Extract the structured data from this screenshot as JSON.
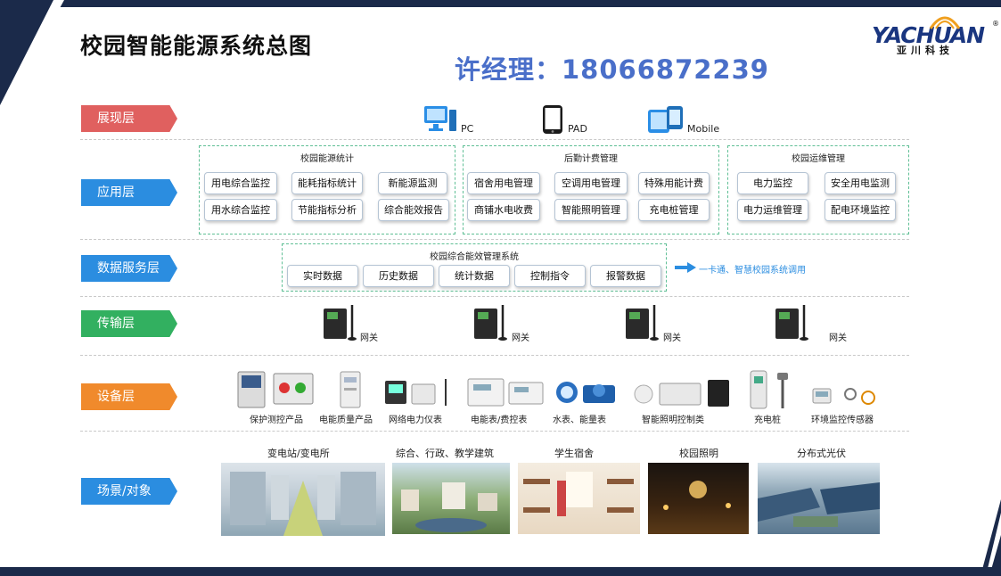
{
  "title": "校园智能能源系统总图",
  "contact": "许经理：18066872239",
  "logo": {
    "text": "YACHUAN",
    "sub": "亚川科技",
    "reg": "®"
  },
  "colors": {
    "presentation": "#e0605f",
    "application": "#2b8de0",
    "data_service": "#2b8de0",
    "transport": "#32b060",
    "device": "#f08a2c",
    "scene": "#2b8de0",
    "group_border": "#5fbf95"
  },
  "layers": {
    "presentation": "展现层",
    "application": "应用层",
    "data_service": "数据服务层",
    "transport": "传输层",
    "device": "设备层",
    "scene": "场景/对象"
  },
  "terminals": [
    {
      "icon": "pc-monitor-icon",
      "label": "PC"
    },
    {
      "icon": "tablet-icon",
      "label": "PAD"
    },
    {
      "icon": "mobile-icon",
      "label": "Mobile"
    }
  ],
  "app_groups": [
    {
      "title": "校园能源统计",
      "items": [
        "用电综合监控",
        "能耗指标统计",
        "新能源监测",
        "用水综合监控",
        "节能指标分析",
        "综合能效报告"
      ]
    },
    {
      "title": "后勤计费管理",
      "items": [
        "宿舍用电管理",
        "空调用电管理",
        "特殊用能计费",
        "商铺水电收费",
        "智能照明管理",
        "充电桩管理"
      ]
    },
    {
      "title": "校园运维管理",
      "items": [
        "电力监控",
        "安全用电监测",
        "电力运维管理",
        "配电环境监控"
      ]
    }
  ],
  "data_system": {
    "title": "校园综合能效管理系统",
    "items": [
      "实时数据",
      "历史数据",
      "统计数据",
      "控制指令",
      "报警数据"
    ],
    "note": "一卡通、智慧校园系统调用"
  },
  "gateways": [
    "网关",
    "网关",
    "网关",
    "网关"
  ],
  "devices": [
    "保护测控产品",
    "电能质量产品",
    "网络电力仪表",
    "电能表/费控表",
    "水表、能量表",
    "智能照明控制类",
    "充电桩",
    "环境监控传感器"
  ],
  "scenes": [
    "变电站/变电所",
    "综合、行政、教学建筑",
    "学生宿舍",
    "校园照明",
    "分布式光伏"
  ]
}
